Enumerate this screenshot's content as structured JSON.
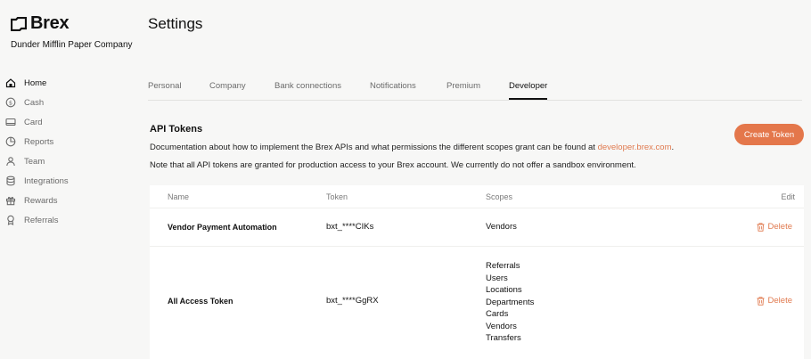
{
  "brand": {
    "name": "Brex",
    "company": "Dunder Mifflin Paper Company"
  },
  "sidebar": {
    "items": [
      {
        "label": "Home",
        "icon": "home-icon",
        "active": true
      },
      {
        "label": "Cash",
        "icon": "dollar-icon",
        "active": false
      },
      {
        "label": "Card",
        "icon": "card-icon",
        "active": false
      },
      {
        "label": "Reports",
        "icon": "pie-chart-icon",
        "active": false
      },
      {
        "label": "Team",
        "icon": "team-icon",
        "active": false
      },
      {
        "label": "Integrations",
        "icon": "database-icon",
        "active": false
      },
      {
        "label": "Rewards",
        "icon": "gift-icon",
        "active": false
      },
      {
        "label": "Referrals",
        "icon": "award-icon",
        "active": false
      }
    ]
  },
  "page": {
    "title": "Settings"
  },
  "tabs": [
    {
      "label": "Personal",
      "active": false
    },
    {
      "label": "Company",
      "active": false
    },
    {
      "label": "Bank connections",
      "active": false
    },
    {
      "label": "Notifications",
      "active": false
    },
    {
      "label": "Premium",
      "active": false
    },
    {
      "label": "Developer",
      "active": true
    }
  ],
  "api_tokens": {
    "title": "API Tokens",
    "doc_text": "Documentation about how to implement the Brex APIs and what permissions the different scopes grant can be found at ",
    "doc_link": "developer.brex.com",
    "doc_end": ".",
    "note": "Note that all API tokens are granted for production access to your Brex account. We currently do not offer a sandbox environment.",
    "create_label": "Create Token",
    "columns": {
      "name": "Name",
      "token": "Token",
      "scopes": "Scopes",
      "edit": "Edit"
    },
    "rows": [
      {
        "name": "Vendor Payment Automation",
        "token": "bxt_****CIKs",
        "scopes": [
          "Vendors"
        ],
        "action": "Delete"
      },
      {
        "name": "All Access Token",
        "token": "bxt_****GgRX",
        "scopes": [
          "Referrals",
          "Users",
          "Locations",
          "Departments",
          "Cards",
          "Vendors",
          "Transfers"
        ],
        "action": "Delete"
      }
    ]
  },
  "colors": {
    "accent": "#e4774b",
    "link": "#e07a4f",
    "background": "#f7f7f6"
  }
}
